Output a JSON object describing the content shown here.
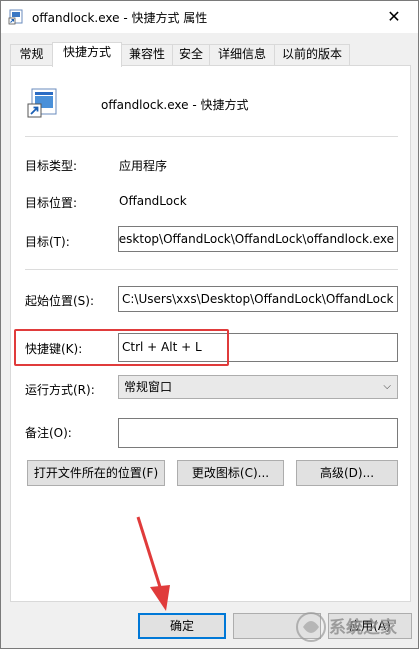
{
  "window": {
    "title": "offandlock.exe - 快捷方式 属性",
    "close_glyph": "✕"
  },
  "tabs": [
    {
      "label": "常规"
    },
    {
      "label": "快捷方式",
      "active": true
    },
    {
      "label": "兼容性"
    },
    {
      "label": "安全"
    },
    {
      "label": "详细信息"
    },
    {
      "label": "以前的版本"
    }
  ],
  "shortcut": {
    "name": "offandlock.exe - 快捷方式",
    "target_type_label": "目标类型:",
    "target_type_value": "应用程序",
    "target_location_label": "目标位置:",
    "target_location_value": "OffandLock",
    "target_label": "目标(T):",
    "target_value": "esktop\\OffandLock\\OffandLock\\offandlock.exe",
    "start_in_label": "起始位置(S):",
    "start_in_value": "C:\\Users\\xxs\\Desktop\\OffandLock\\OffandLock",
    "hotkey_label": "快捷键(K):",
    "hotkey_value": "Ctrl + Alt + L",
    "run_label": "运行方式(R):",
    "run_value": "常规窗口",
    "comment_label": "备注(O):",
    "comment_value": ""
  },
  "buttons": {
    "open_location": "打开文件所在的位置(F)",
    "change_icon": "更改图标(C)...",
    "advanced": "高级(D)...",
    "ok": "确定",
    "apply": "应用(A)"
  },
  "annotation": {
    "highlight_color": "#e03b3b",
    "arrow_color": "#e03b3b"
  },
  "watermark": {
    "text": "系统之家"
  },
  "icons": {
    "title_icon": "shortcut-icon",
    "big_icon": "shortcut-icon",
    "dropdown": "chevron-down-icon",
    "close": "close-icon"
  }
}
